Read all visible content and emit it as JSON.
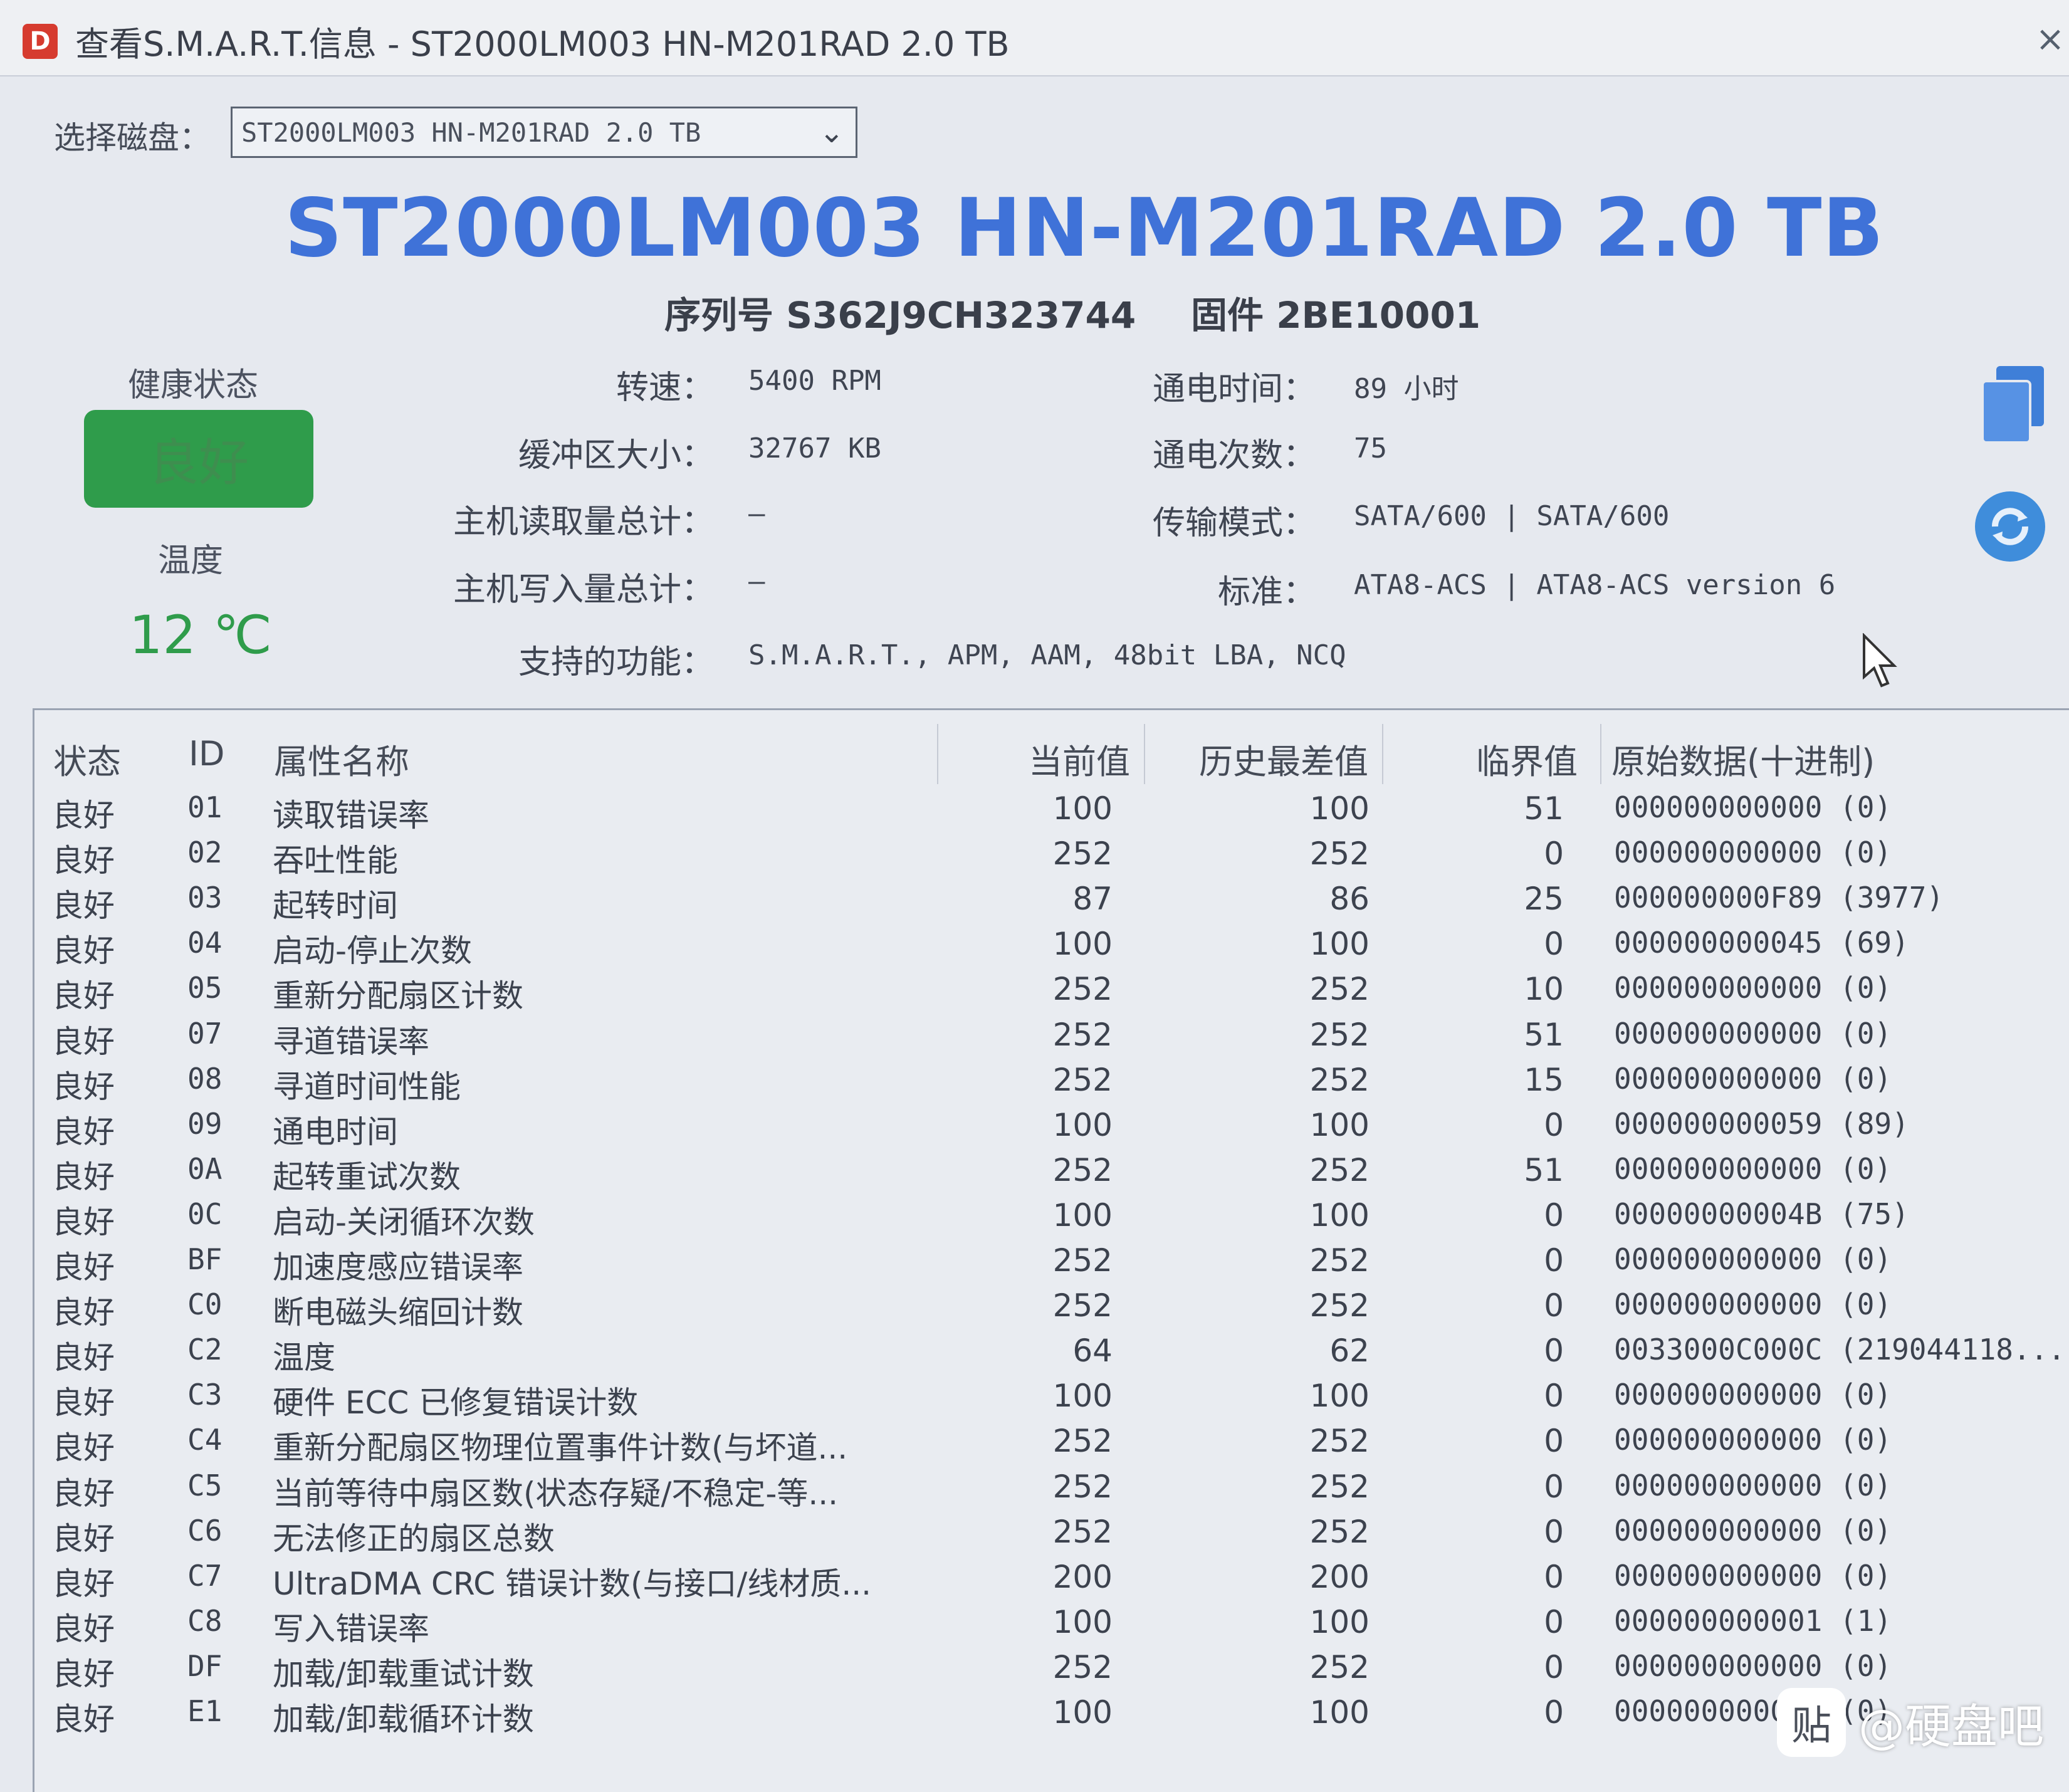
{
  "window": {
    "title": "查看S.M.A.R.T.信息 - ST2000LM003 HN-M201RAD 2.0 TB",
    "close_glyph": "×"
  },
  "disk_select": {
    "label": "选择磁盘：",
    "value": "ST2000LM003 HN-M201RAD 2.0 TB"
  },
  "model": "ST2000LM003 HN-M201RAD 2.0 TB",
  "serial": "序列号 S362J9CH323744",
  "firmware": "固件 2BE10001",
  "health": {
    "label": "健康状态",
    "value": "良好",
    "color": "#2f9c4b"
  },
  "temperature": {
    "label": "温度",
    "value": "12 ℃"
  },
  "info": {
    "rpm_label": "转速：",
    "rpm": "5400 RPM",
    "buffer_label": "缓冲区大小：",
    "buffer": "32767 KB",
    "host_read_label": "主机读取量总计：",
    "host_read": "—",
    "host_write_label": "主机写入量总计：",
    "host_write": "—",
    "features_label": "支持的功能：",
    "features": "S.M.A.R.T., APM, AAM, 48bit LBA, NCQ",
    "power_on_hours_label": "通电时间：",
    "power_on_hours": "89 小时",
    "power_count_label": "通电次数：",
    "power_count": "75",
    "transfer_label": "传输模式：",
    "transfer": "SATA/600 | SATA/600",
    "standard_label": "标准：",
    "standard": "ATA8-ACS | ATA8-ACS version 6"
  },
  "table": {
    "headers": [
      "状态",
      "ID",
      "属性名称",
      "当前值",
      "历史最差值",
      "临界值",
      "原始数据(十进制)"
    ],
    "rows": [
      {
        "s": "良好",
        "id": "01",
        "name": "读取错误率",
        "cur": "100",
        "worst": "100",
        "thr": "51",
        "raw": "000000000000 (0)"
      },
      {
        "s": "良好",
        "id": "02",
        "name": "吞吐性能",
        "cur": "252",
        "worst": "252",
        "thr": "0",
        "raw": "000000000000 (0)"
      },
      {
        "s": "良好",
        "id": "03",
        "name": "起转时间",
        "cur": "87",
        "worst": "86",
        "thr": "25",
        "raw": "000000000F89 (3977)"
      },
      {
        "s": "良好",
        "id": "04",
        "name": "启动-停止次数",
        "cur": "100",
        "worst": "100",
        "thr": "0",
        "raw": "000000000045 (69)"
      },
      {
        "s": "良好",
        "id": "05",
        "name": "重新分配扇区计数",
        "cur": "252",
        "worst": "252",
        "thr": "10",
        "raw": "000000000000 (0)"
      },
      {
        "s": "良好",
        "id": "07",
        "name": "寻道错误率",
        "cur": "252",
        "worst": "252",
        "thr": "51",
        "raw": "000000000000 (0)"
      },
      {
        "s": "良好",
        "id": "08",
        "name": "寻道时间性能",
        "cur": "252",
        "worst": "252",
        "thr": "15",
        "raw": "000000000000 (0)"
      },
      {
        "s": "良好",
        "id": "09",
        "name": "通电时间",
        "cur": "100",
        "worst": "100",
        "thr": "0",
        "raw": "000000000059 (89)"
      },
      {
        "s": "良好",
        "id": "0A",
        "name": "起转重试次数",
        "cur": "252",
        "worst": "252",
        "thr": "51",
        "raw": "000000000000 (0)"
      },
      {
        "s": "良好",
        "id": "0C",
        "name": "启动-关闭循环次数",
        "cur": "100",
        "worst": "100",
        "thr": "0",
        "raw": "00000000004B (75)"
      },
      {
        "s": "良好",
        "id": "BF",
        "name": "加速度感应错误率",
        "cur": "252",
        "worst": "252",
        "thr": "0",
        "raw": "000000000000 (0)"
      },
      {
        "s": "良好",
        "id": "C0",
        "name": "断电磁头缩回计数",
        "cur": "252",
        "worst": "252",
        "thr": "0",
        "raw": "000000000000 (0)"
      },
      {
        "s": "良好",
        "id": "C2",
        "name": "温度",
        "cur": "64",
        "worst": "62",
        "thr": "0",
        "raw": "0033000C000C (219044118..."
      },
      {
        "s": "良好",
        "id": "C3",
        "name": "硬件 ECC 已修复错误计数",
        "cur": "100",
        "worst": "100",
        "thr": "0",
        "raw": "000000000000 (0)"
      },
      {
        "s": "良好",
        "id": "C4",
        "name": "重新分配扇区物理位置事件计数(与坏道...",
        "cur": "252",
        "worst": "252",
        "thr": "0",
        "raw": "000000000000 (0)"
      },
      {
        "s": "良好",
        "id": "C5",
        "name": "当前等待中扇区数(状态存疑/不稳定-等...",
        "cur": "252",
        "worst": "252",
        "thr": "0",
        "raw": "000000000000 (0)"
      },
      {
        "s": "良好",
        "id": "C6",
        "name": "无法修正的扇区总数",
        "cur": "252",
        "worst": "252",
        "thr": "0",
        "raw": "000000000000 (0)"
      },
      {
        "s": "良好",
        "id": "C7",
        "name": "UltraDMA CRC 错误计数(与接口/线材质...",
        "cur": "200",
        "worst": "200",
        "thr": "0",
        "raw": "000000000000 (0)"
      },
      {
        "s": "良好",
        "id": "C8",
        "name": "写入错误率",
        "cur": "100",
        "worst": "100",
        "thr": "0",
        "raw": "000000000001 (1)"
      },
      {
        "s": "良好",
        "id": "DF",
        "name": "加载/卸载重试计数",
        "cur": "252",
        "worst": "252",
        "thr": "0",
        "raw": "000000000000 (0)"
      },
      {
        "s": "良好",
        "id": "E1",
        "name": "加载/卸载循环计数",
        "cur": "100",
        "worst": "100",
        "thr": "0",
        "raw": "000000000000 (0)"
      }
    ]
  },
  "watermark": {
    "logo": "贴",
    "text": "@硬盘吧"
  }
}
